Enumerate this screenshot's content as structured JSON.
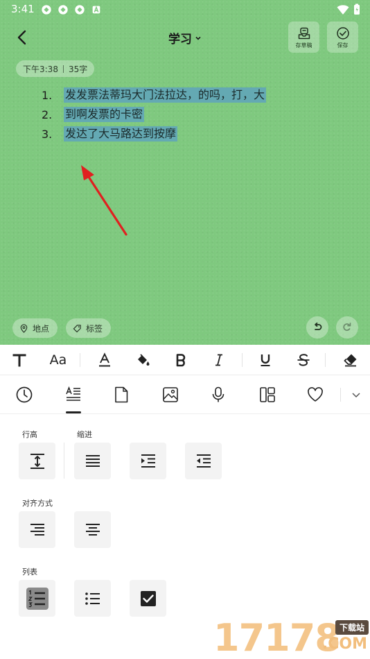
{
  "status_bar": {
    "time": "3:41"
  },
  "header": {
    "title": "学习",
    "draft_label": "存草稿",
    "save_label": "保存"
  },
  "note_meta": {
    "time": "下午3:38",
    "word_count": "35字"
  },
  "list_items": [
    {
      "num": "1.",
      "text": "发发票法蒂玛大门法拉达，的吗，打，大"
    },
    {
      "num": "2.",
      "text": "到啊发票的卡密"
    },
    {
      "num": "3.",
      "text": "发达了大马路达到按摩"
    }
  ],
  "chips": {
    "location": "地点",
    "tag": "标签"
  },
  "format_toolbar": {
    "font_size_label": "Aa"
  },
  "panel": {
    "line_height_label": "行高",
    "indent_label": "缩进",
    "align_label": "对齐方式",
    "list_label": "列表"
  },
  "watermark": {
    "number": "17178",
    "tag": "下载站",
    "domain": ".COM"
  },
  "colors": {
    "editor_bg": "#7fc97f",
    "highlight": "#64a9b3",
    "arrow": "#e02020"
  }
}
